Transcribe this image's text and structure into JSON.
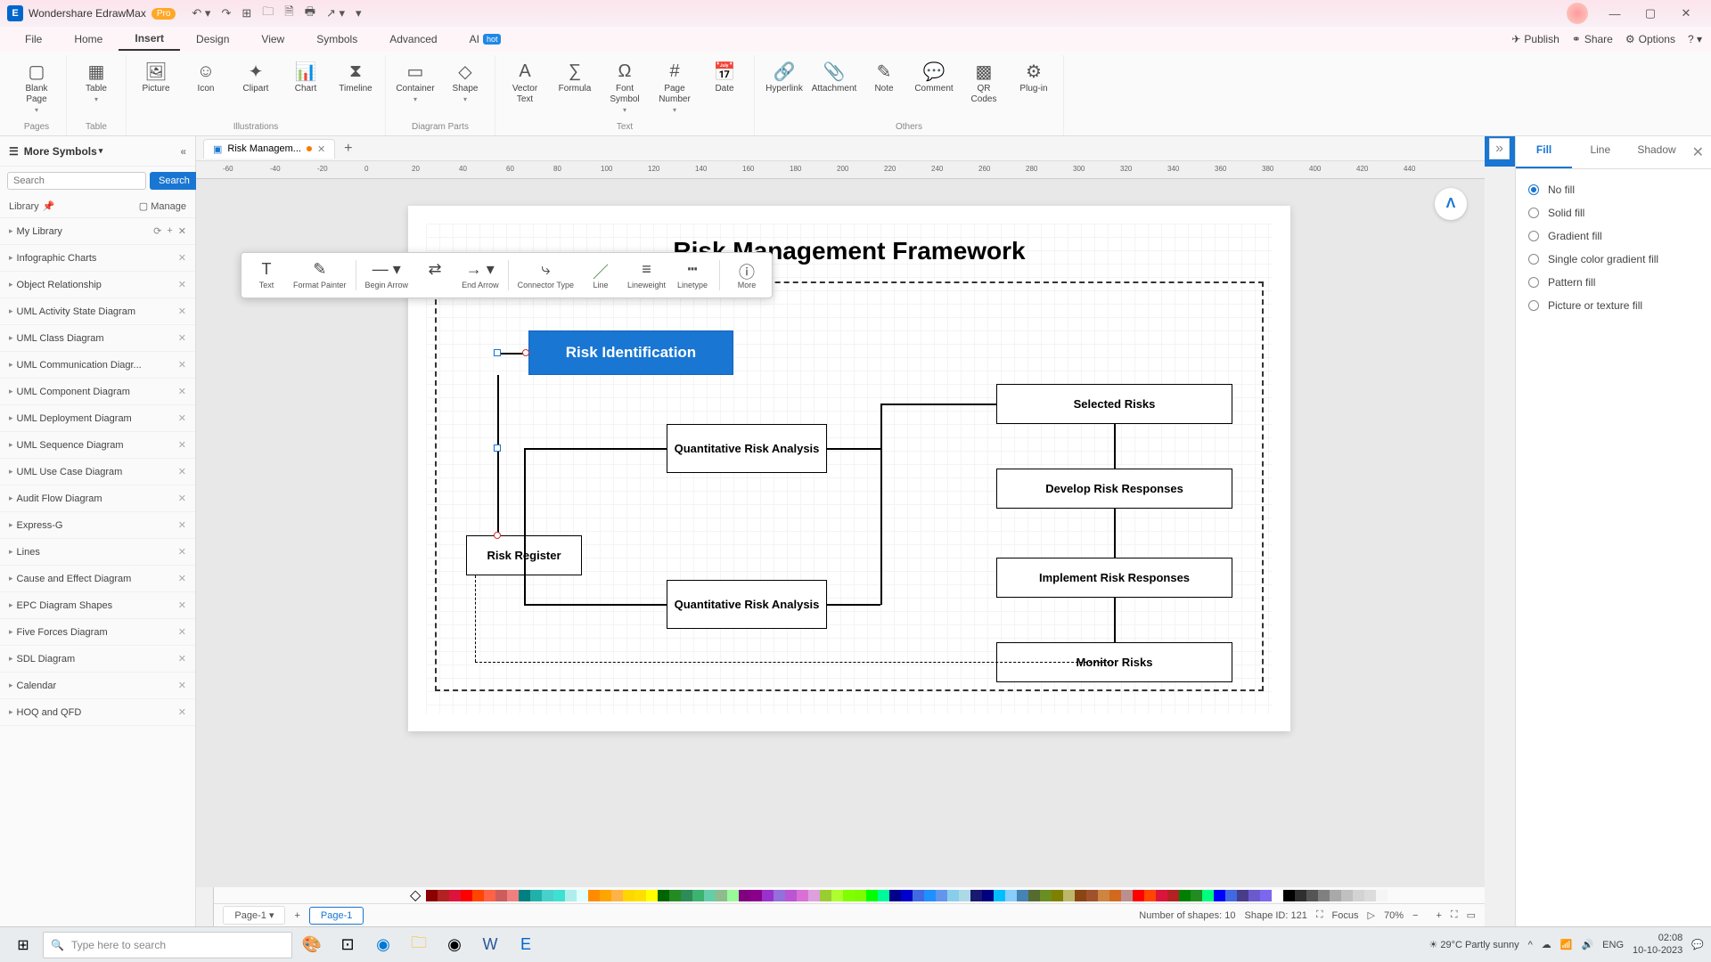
{
  "titlebar": {
    "app_name": "Wondershare EdrawMax",
    "pro": "Pro"
  },
  "menu": {
    "items": [
      "File",
      "Home",
      "Insert",
      "Design",
      "View",
      "Symbols",
      "Advanced",
      "AI"
    ],
    "active": "Insert",
    "hot": "hot",
    "publish": "Publish",
    "share": "Share",
    "options": "Options"
  },
  "ribbon": {
    "groups": [
      {
        "label": "Pages",
        "tools": [
          {
            "label": "Blank Page",
            "icon": "▢",
            "dd": true
          }
        ]
      },
      {
        "label": "Table",
        "tools": [
          {
            "label": "Table",
            "icon": "▦",
            "dd": true
          }
        ]
      },
      {
        "label": "Illustrations",
        "tools": [
          {
            "label": "Picture",
            "icon": "🖼"
          },
          {
            "label": "Icon",
            "icon": "☺"
          },
          {
            "label": "Clipart",
            "icon": "✦"
          },
          {
            "label": "Chart",
            "icon": "📊"
          },
          {
            "label": "Timeline",
            "icon": "⧗"
          }
        ]
      },
      {
        "label": "Diagram Parts",
        "tools": [
          {
            "label": "Container",
            "icon": "▭",
            "dd": true
          },
          {
            "label": "Shape",
            "icon": "◇",
            "dd": true
          }
        ]
      },
      {
        "label": "Text",
        "tools": [
          {
            "label": "Vector Text",
            "icon": "A"
          },
          {
            "label": "Formula",
            "icon": "∑"
          },
          {
            "label": "Font Symbol",
            "icon": "Ω",
            "dd": true
          },
          {
            "label": "Page Number",
            "icon": "#",
            "dd": true
          },
          {
            "label": "Date",
            "icon": "📅"
          }
        ]
      },
      {
        "label": "Others",
        "tools": [
          {
            "label": "Hyperlink",
            "icon": "🔗"
          },
          {
            "label": "Attachment",
            "icon": "📎"
          },
          {
            "label": "Note",
            "icon": "✎"
          },
          {
            "label": "Comment",
            "icon": "💬"
          },
          {
            "label": "QR Codes",
            "icon": "▩"
          },
          {
            "label": "Plug-in",
            "icon": "⚙"
          }
        ]
      }
    ]
  },
  "left": {
    "title": "More Symbols",
    "search_ph": "Search",
    "search_btn": "Search",
    "library": "Library",
    "manage": "Manage",
    "items": [
      {
        "name": "My Library",
        "extra": true
      },
      {
        "name": "Infographic Charts"
      },
      {
        "name": "Object Relationship"
      },
      {
        "name": "UML Activity State Diagram"
      },
      {
        "name": "UML Class Diagram"
      },
      {
        "name": "UML Communication Diagr..."
      },
      {
        "name": "UML Component Diagram"
      },
      {
        "name": "UML Deployment Diagram"
      },
      {
        "name": "UML Sequence Diagram"
      },
      {
        "name": "UML Use Case Diagram"
      },
      {
        "name": "Audit Flow Diagram"
      },
      {
        "name": "Express-G"
      },
      {
        "name": "Lines"
      },
      {
        "name": "Cause and Effect Diagram"
      },
      {
        "name": "EPC Diagram Shapes"
      },
      {
        "name": "Five Forces Diagram"
      },
      {
        "name": "SDL Diagram"
      },
      {
        "name": "Calendar"
      },
      {
        "name": "HOQ and QFD"
      }
    ]
  },
  "doc": {
    "tab_name": "Risk Managem...",
    "title": "Risk Management Framework",
    "boxes": {
      "risk_id": "Risk Identification",
      "qra1": "Quantitative Risk Analysis",
      "risk_reg": "Risk Register",
      "qra2": "Quantitative Risk Analysis",
      "sel_risks": "Selected Risks",
      "dev_resp": "Develop Risk Responses",
      "imp_resp": "Implement Risk Responses",
      "mon_risks": "Monitor Risks"
    }
  },
  "ctx": {
    "text": "Text",
    "fmt": "Format Painter",
    "begin": "Begin Arrow",
    "end": "End Arrow",
    "conn": "Connector Type",
    "line": "Line",
    "lw": "Lineweight",
    "lt": "Linetype",
    "more": "More"
  },
  "right": {
    "tabs": [
      "Fill",
      "Line",
      "Shadow"
    ],
    "opts": [
      "No fill",
      "Solid fill",
      "Gradient fill",
      "Single color gradient fill",
      "Pattern fill",
      "Picture or texture fill"
    ],
    "selected": 0
  },
  "pagetabs": {
    "dropdown": "Page-1",
    "tab": "Page-1"
  },
  "status": {
    "shapes": "Number of shapes: 10",
    "shapeid": "Shape ID: 121",
    "focus": "Focus",
    "zoom": "70%"
  },
  "taskbar": {
    "search_ph": "Type here to search",
    "weather": "29°C  Partly sunny",
    "time": "02:08",
    "date": "10-10-2023"
  },
  "ruler_ticks": [
    "-60",
    "-40",
    "-20",
    "0",
    "20",
    "40",
    "60",
    "80",
    "100",
    "120",
    "140",
    "160",
    "180",
    "200",
    "220",
    "240",
    "260",
    "280",
    "300",
    "320",
    "340",
    "360",
    "380",
    "400",
    "420",
    "440"
  ],
  "palette": [
    "#8b0000",
    "#b22222",
    "#dc143c",
    "#ff0000",
    "#ff4500",
    "#ff6347",
    "#cd5c5c",
    "#f08080",
    "#008080",
    "#20b2aa",
    "#48d1cc",
    "#40e0d0",
    "#afeeee",
    "#e0ffff",
    "#ff8c00",
    "#ffa500",
    "#ffb347",
    "#ffd700",
    "#ffdf00",
    "#ffff00",
    "#006400",
    "#228b22",
    "#2e8b57",
    "#3cb371",
    "#66cdaa",
    "#8fbc8f",
    "#98fb98",
    "#800080",
    "#8b008b",
    "#9932cc",
    "#9370db",
    "#ba55d3",
    "#da70d6",
    "#dda0dd",
    "#9acd32",
    "#adff2f",
    "#7fff00",
    "#7cfc00",
    "#00ff00",
    "#00fa9a",
    "#00008b",
    "#0000cd",
    "#4169e1",
    "#1e90ff",
    "#6495ed",
    "#87ceeb",
    "#add8e6",
    "#191970",
    "#000080",
    "#00bfff",
    "#87cefa",
    "#4682b4",
    "#556b2f",
    "#6b8e23",
    "#808000",
    "#bdb76b",
    "#8b4513",
    "#a0522d",
    "#cd853f",
    "#d2691e",
    "#bc8f8f",
    "#ff0000",
    "#ff4500",
    "#dc143c",
    "#b22222",
    "#008000",
    "#228b22",
    "#00ff7f",
    "#0000ff",
    "#4169e1",
    "#483d8b",
    "#6a5acd",
    "#7b68ee",
    "#ffffff",
    "#000000",
    "#2f2f2f",
    "#555555",
    "#808080",
    "#a9a9a9",
    "#c0c0c0",
    "#d3d3d3",
    "#dcdcdc",
    "#f5f5f5"
  ]
}
